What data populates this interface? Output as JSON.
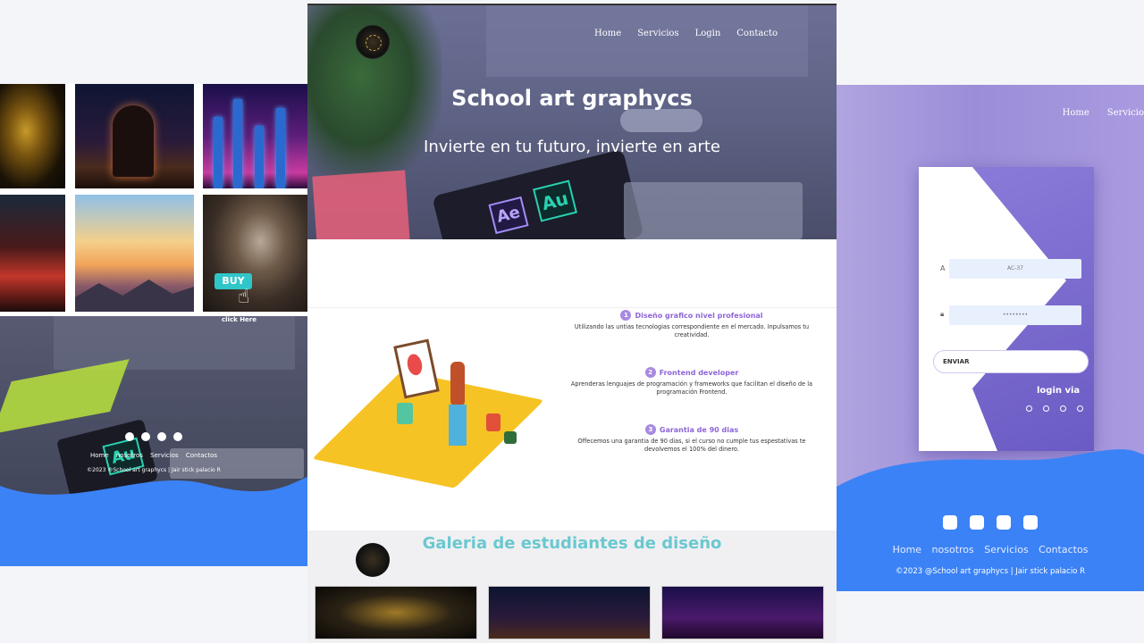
{
  "left_panel": {
    "gallery_thumbs": [
      "golden-warrior",
      "night-sky-arch",
      "neon-city",
      "red-neon-street",
      "sunset-mountains",
      "kratos-warrior"
    ],
    "buy_label": "BUY",
    "click_label": "click Here",
    "footer": {
      "links": [
        "Home",
        "nosotros",
        "Servicios",
        "Contactos"
      ],
      "copyright": "©2023 ®School art graphycs | Jair stick palacio R"
    }
  },
  "center_panel": {
    "nav": [
      "Home",
      "Servicios",
      "Login",
      "Contacto"
    ],
    "hero": {
      "title": "School art graphycs",
      "subtitle": "Invierte en tu futuro, invierte en arte",
      "tablet_labels": [
        "Ae",
        "Au"
      ]
    },
    "features": [
      {
        "num": "1",
        "title": "Diseño grafico nivel profesional",
        "desc": "Utilizando las untias tecnologias correspondiente en el mercado. Inpulsamos tu creatividad."
      },
      {
        "num": "2",
        "title": "Frontend developer",
        "desc": "Aprenderas lenguajes de programación y frameworks que facilitan el diseño de la programación Frontend."
      },
      {
        "num": "3",
        "title": "Garantia de 90 dias",
        "desc": "Offecemos una garantia de 90 dias, si el curso no cumple tus espestativas te devolvemos el 100% del dinero."
      }
    ],
    "gallery_title": "Galeria de estudiantes de diseño"
  },
  "right_panel": {
    "nav": [
      "Home",
      "Servicio"
    ],
    "form": {
      "user_value": "AC-37",
      "password_value": "••••••••",
      "submit_label": "ENVIAR",
      "login_via": "login via"
    },
    "footer": {
      "links": [
        "Home",
        "nosotros",
        "Servicios",
        "Contactos"
      ],
      "copyright": "©2023 @School art graphycs | Jair stick palacio R"
    }
  },
  "colors": {
    "footer_blue": "#3b82f6",
    "purple_accent": "#8e66d6",
    "gallery_title": "#6ac8d0",
    "buy_teal": "#2fc6c9"
  },
  "icons": [
    "facebook-icon",
    "twitter-icon",
    "linkedin-icon",
    "instagram-icon",
    "whatsapp-icon",
    "user-icon",
    "lock-icon",
    "pointer-hand-icon"
  ]
}
